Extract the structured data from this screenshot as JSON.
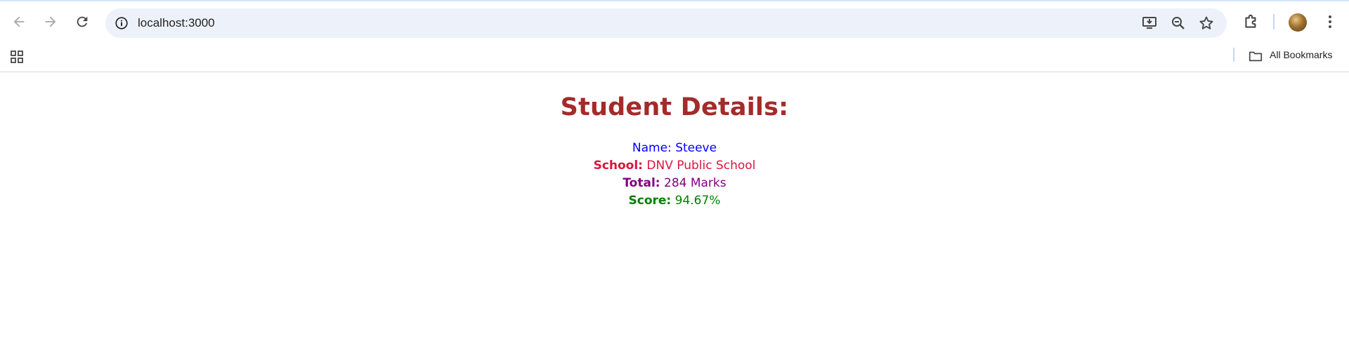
{
  "browser": {
    "url": "localhost:3000",
    "bookmarks_label": "All Bookmarks",
    "icons": {
      "back": "arrow-left-icon",
      "forward": "arrow-right-icon",
      "reload": "reload-icon",
      "site_info": "info-icon",
      "install": "install-app-icon",
      "zoom": "zoom-out-icon",
      "bookmark": "star-icon",
      "extensions": "puzzle-icon",
      "menu": "kebab-menu-icon",
      "apps": "apps-grid-icon",
      "folder": "folder-icon"
    }
  },
  "page": {
    "heading": "Student Details:",
    "name": {
      "label": "Name:",
      "value": "Steeve",
      "color": "#0000ff"
    },
    "school": {
      "label": "School:",
      "value": "DNV Public School",
      "color": "#dc143c"
    },
    "total": {
      "label": "Total:",
      "value": "284 Marks",
      "color": "#800080"
    },
    "score": {
      "label": "Score:",
      "value": "94.67%",
      "color": "#008000"
    },
    "heading_color": "#a52a2a"
  }
}
